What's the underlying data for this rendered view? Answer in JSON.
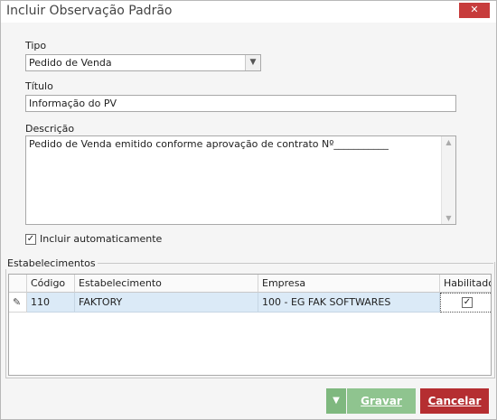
{
  "window": {
    "title": "Incluir Observação Padrão",
    "close_glyph": "✕"
  },
  "form": {
    "tipo_label": "Tipo",
    "tipo_value": "Pedido de Venda",
    "titulo_label": "Título",
    "titulo_value": "Informação do PV",
    "descricao_label": "Descrição",
    "descricao_value": "Pedido de Venda emitido conforme aprovação de contrato Nº___________",
    "auto_label": "Incluir automaticamente",
    "auto_checked": true
  },
  "estabelecimentos": {
    "group_label": "Estabelecimentos",
    "columns": [
      "Código",
      "Estabelecimento",
      "Empresa",
      "Habilitado"
    ],
    "rows": [
      {
        "codigo": "110",
        "estabelecimento": "FAKTORY",
        "empresa": "100 - EG FAK SOFTWARES",
        "habilitado": true
      }
    ]
  },
  "buttons": {
    "gravar": "Gravar",
    "cancelar": "Cancelar"
  },
  "colors": {
    "cancel": "#b52e31",
    "save": "#8fc48f",
    "row_selected": "#dbeaf7"
  },
  "icons": {
    "row_indicator": "pencil-icon",
    "dropdown": "chevron-down-icon",
    "save_arrow": "triangle-down-icon"
  }
}
